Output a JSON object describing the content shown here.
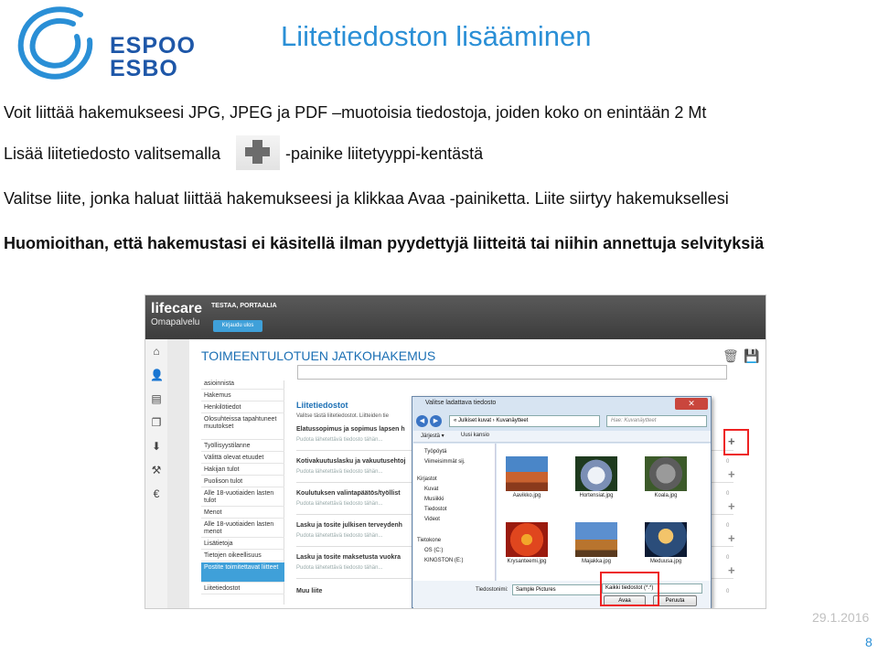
{
  "logo": {
    "line1": "ESPOO",
    "line2": "ESBO",
    "color": "#1e57a8"
  },
  "slide": {
    "title": "Liitetiedoston lisääminen",
    "line1": "Voit liittää hakemukseesi JPG, JPEG ja PDF –muotoisia tiedostoja, joiden koko on enintään 2 Mt",
    "line2a": "Lisää liitetiedosto valitsemalla",
    "line2b": "-painike liitetyyppi-kentästä",
    "line3": "Valitse liite, jonka haluat liittää hakemukseesi ja klikkaa Avaa -painiketta. Liite siirtyy hakemuksellesi",
    "line4": "Huomioithan, että hakemustasi ei käsitellä ilman pyydettyjä liitteitä tai niihin annettuja selvityksiä",
    "date": "29.1.2016",
    "page": "8",
    "title_color": "#2a8fd6"
  },
  "app": {
    "name": "lifecare",
    "sub": "Omapalvelu",
    "user": "TESTAA, PORTAALIA",
    "logout": "Kirjaudu ulos",
    "form_title": "TOIMEENTULOTUEN JATKOHAKEMUS",
    "left_icons": [
      "home-icon",
      "person-icon",
      "document-icon",
      "documents-icon",
      "inbox-icon",
      "gavel-icon",
      "euro-icon"
    ],
    "nav": [
      "asioinnista",
      "Hakemus",
      "Henkilötiedot",
      "Olosuhteissa tapahtuneet muutokset",
      "Työllisyystilanne",
      "Välittä olevat etuudet",
      "Hakijan tulot",
      "Puolison tulot",
      "Alle 18-vuotiaiden lasten tulot",
      "Menot",
      "Alle 18-vuotiaiden lasten menot",
      "Lisätietoja",
      "Tietojen oikeellisuus",
      "Postite toimitettavat liitteet",
      "Liitetiedostot"
    ],
    "nav_selected": 13,
    "attach_head": "Liitetiedostot",
    "attach_desc": "Valitse tästä liitetiedostot. Liitteiden tie",
    "attachments": [
      {
        "label": "Elatussopimus ja sopimus lapsen h",
        "hint": "Pudota lähetettävä tiedosto tähän..."
      },
      {
        "label": "Kotivakuutuslasku ja vakuutusehtoj",
        "hint": "Pudota lähetettävä tiedosto tähän..."
      },
      {
        "label": "Koulutuksen valintapäätös/työllist",
        "hint": "Pudota lähetettävä tiedosto tähän..."
      },
      {
        "label": "Lasku ja tosite julkisen terveydenh",
        "hint": "Pudota lähetettävä tiedosto tähän..."
      },
      {
        "label": "Lasku ja tosite maksetusta vuokra",
        "hint": "Pudota lähetettävä tiedosto tähän..."
      },
      {
        "label": "Muu liite",
        "hint": ""
      }
    ],
    "plus_glyph": "+",
    "zero": "0"
  },
  "dialog": {
    "title": "Valitse ladattava tiedosto",
    "close": "✕",
    "path": "« Julkiset kuvat › Kuvanäytteet",
    "search": "Hae: Kuvanäytteet",
    "organize": "Järjestä ▾",
    "new_folder": "Uusi kansio",
    "tree": [
      "Työpöytä",
      "Viimeisimmät sij.",
      "Kirjastot",
      "Kuvat",
      "Musiikki",
      "Tiedostot",
      "Videot",
      "Tietokone",
      "OS (C:)",
      "KINGSTON (E:)"
    ],
    "files": [
      "Aavikko.jpg",
      "Hortensiat.jpg",
      "Koala.jpg",
      "Krysanteemi.jpg",
      "Majakka.jpg",
      "Meduusa.jpg"
    ],
    "filename_label": "Tiedostonimi:",
    "filename": "Sample Pictures",
    "filetype": "Kaikki tiedostot (*.*)",
    "open": "Avaa",
    "cancel": "Peruuta"
  }
}
